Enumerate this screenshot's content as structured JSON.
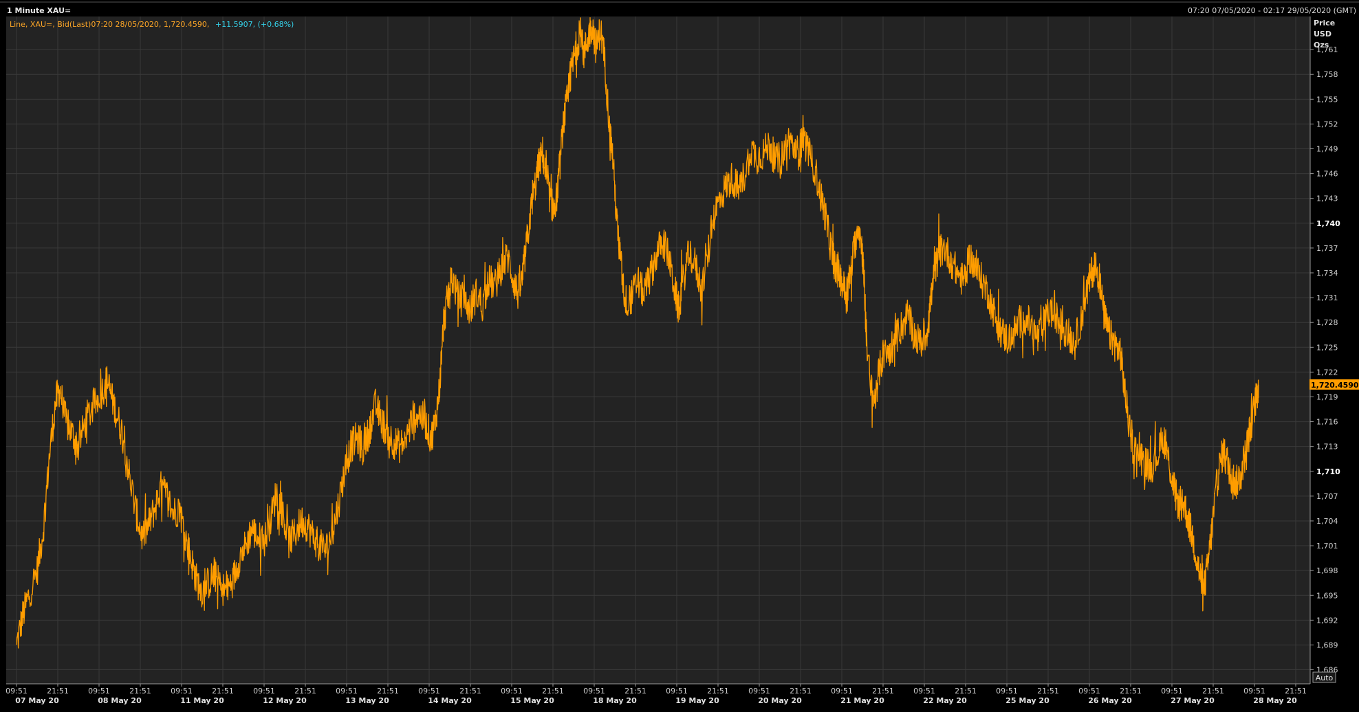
{
  "window": {
    "title": "1 Minute XAU=",
    "time_range": "07:20 07/05/2020 - 02:17 29/05/2020 (GMT)"
  },
  "legend": {
    "text": "Line, XAU=, Bid(Last)07:20 28/05/2020, 1,720.4590,",
    "change": "+11.5907, (+0.68%)",
    "color": "#ffa726",
    "change_color": "#35d2ea"
  },
  "axis_units": {
    "line1": "Price",
    "line2": "USD",
    "line3": "Ozs"
  },
  "auto_button": {
    "label": "Auto"
  },
  "colors": {
    "background": "#232323",
    "grid": "#3a3a3a",
    "line": "#ff9d00",
    "marker_bg": "#ff9d00",
    "marker_text": "#000000"
  },
  "chart_data": {
    "type": "line",
    "title": "1 Minute XAU=",
    "ylabel": "Price USD Ozs",
    "ylim": [
      1684.3,
      1765.0
    ],
    "y_ticks": [
      {
        "value": 1761,
        "label": "1,761",
        "bold": false
      },
      {
        "value": 1758,
        "label": "1,758",
        "bold": false
      },
      {
        "value": 1755,
        "label": "1,755",
        "bold": false
      },
      {
        "value": 1752,
        "label": "1,752",
        "bold": false
      },
      {
        "value": 1749,
        "label": "1,749",
        "bold": false
      },
      {
        "value": 1746,
        "label": "1,746",
        "bold": false
      },
      {
        "value": 1743,
        "label": "1,743",
        "bold": false
      },
      {
        "value": 1740,
        "label": "1,740",
        "bold": true
      },
      {
        "value": 1737,
        "label": "1,737",
        "bold": false
      },
      {
        "value": 1734,
        "label": "1,734",
        "bold": false
      },
      {
        "value": 1731,
        "label": "1,731",
        "bold": false
      },
      {
        "value": 1728,
        "label": "1,728",
        "bold": false
      },
      {
        "value": 1725,
        "label": "1,725",
        "bold": false
      },
      {
        "value": 1722,
        "label": "1,722",
        "bold": false
      },
      {
        "value": 1719,
        "label": "1,719",
        "bold": false
      },
      {
        "value": 1716,
        "label": "1,716",
        "bold": false
      },
      {
        "value": 1713,
        "label": "1,713",
        "bold": false
      },
      {
        "value": 1710,
        "label": "1,710",
        "bold": true
      },
      {
        "value": 1707,
        "label": "1,707",
        "bold": false
      },
      {
        "value": 1704,
        "label": "1,704",
        "bold": false
      },
      {
        "value": 1701,
        "label": "1,701",
        "bold": false
      },
      {
        "value": 1698,
        "label": "1,698",
        "bold": false
      },
      {
        "value": 1695,
        "label": "1,695",
        "bold": false
      },
      {
        "value": 1692,
        "label": "1,692",
        "bold": false
      },
      {
        "value": 1689,
        "label": "1,689",
        "bold": false
      },
      {
        "value": 1686,
        "label": "1,686",
        "bold": false
      }
    ],
    "x_session_ticks": [
      "09:51",
      "21:51",
      "09:51",
      "21:51",
      "09:51",
      "21:51",
      "09:51",
      "21:51",
      "09:51",
      "21:51",
      "09:51",
      "21:51",
      "09:51",
      "21:51",
      "09:51",
      "21:51",
      "09:51",
      "21:51",
      "09:51",
      "21:51",
      "09:51",
      "21:51",
      "09:51",
      "21:51",
      "09:51",
      "21:51",
      "09:51",
      "21:51",
      "09:51",
      "21:51",
      "09:51",
      "21:51"
    ],
    "x_dates": [
      "07 May 20",
      "08 May 20",
      "11 May 20",
      "12 May 20",
      "13 May 20",
      "14 May 20",
      "15 May 20",
      "18 May 20",
      "19 May 20",
      "20 May 20",
      "21 May 20",
      "22 May 20",
      "25 May 20",
      "26 May 20",
      "27 May 20",
      "28 May 20"
    ],
    "last_value": {
      "value": 1720.459,
      "label": "1,720.4590"
    },
    "series": [
      {
        "name": "XAU= Bid(Last)",
        "color": "#ff9d00",
        "points": [
          [
            0.0,
            1689.0
          ],
          [
            0.15,
            1692.5
          ],
          [
            0.3,
            1695.0
          ],
          [
            0.5,
            1698.0
          ],
          [
            0.65,
            1703.0
          ],
          [
            0.8,
            1712.0
          ],
          [
            0.95,
            1718.5
          ],
          [
            1.05,
            1720.0
          ],
          [
            1.2,
            1716.0
          ],
          [
            1.35,
            1714.5
          ],
          [
            1.5,
            1713.0
          ],
          [
            1.7,
            1716.5
          ],
          [
            1.9,
            1718.0
          ],
          [
            2.05,
            1719.5
          ],
          [
            2.2,
            1721.0
          ],
          [
            2.3,
            1719.0
          ],
          [
            2.45,
            1716.5
          ],
          [
            2.6,
            1714.0
          ],
          [
            2.75,
            1709.0
          ],
          [
            2.9,
            1705.0
          ],
          [
            3.05,
            1702.0
          ],
          [
            3.2,
            1703.5
          ],
          [
            3.35,
            1705.5
          ],
          [
            3.5,
            1708.0
          ],
          [
            3.65,
            1707.0
          ],
          [
            3.8,
            1705.0
          ],
          [
            3.95,
            1705.5
          ],
          [
            4.1,
            1702.0
          ],
          [
            4.25,
            1699.0
          ],
          [
            4.35,
            1697.0
          ],
          [
            4.5,
            1695.5
          ],
          [
            4.65,
            1696.5
          ],
          [
            4.8,
            1697.5
          ],
          [
            4.95,
            1696.0
          ],
          [
            5.1,
            1695.5
          ],
          [
            5.25,
            1697.0
          ],
          [
            5.4,
            1699.5
          ],
          [
            5.55,
            1701.0
          ],
          [
            5.7,
            1703.0
          ],
          [
            5.85,
            1702.0
          ],
          [
            6.0,
            1701.5
          ],
          [
            6.15,
            1704.0
          ],
          [
            6.3,
            1707.5
          ],
          [
            6.45,
            1705.0
          ],
          [
            6.6,
            1701.5
          ],
          [
            6.75,
            1702.5
          ],
          [
            6.9,
            1704.0
          ],
          [
            7.05,
            1703.5
          ],
          [
            7.2,
            1702.0
          ],
          [
            7.35,
            1701.0
          ],
          [
            7.5,
            1700.5
          ],
          [
            7.65,
            1702.5
          ],
          [
            7.8,
            1706.0
          ],
          [
            7.95,
            1710.0
          ],
          [
            8.1,
            1713.0
          ],
          [
            8.25,
            1714.0
          ],
          [
            8.4,
            1712.5
          ],
          [
            8.55,
            1715.0
          ],
          [
            8.7,
            1718.0
          ],
          [
            8.85,
            1716.0
          ],
          [
            9.0,
            1714.5
          ],
          [
            9.15,
            1713.5
          ],
          [
            9.3,
            1713.0
          ],
          [
            9.45,
            1714.0
          ],
          [
            9.6,
            1716.5
          ],
          [
            9.75,
            1717.0
          ],
          [
            9.9,
            1716.0
          ],
          [
            10.05,
            1714.0
          ],
          [
            10.15,
            1716.0
          ],
          [
            10.25,
            1720.0
          ],
          [
            10.35,
            1728.0
          ],
          [
            10.45,
            1731.0
          ],
          [
            10.55,
            1733.5
          ],
          [
            10.7,
            1731.0
          ],
          [
            10.85,
            1730.5
          ],
          [
            11.0,
            1729.5
          ],
          [
            11.15,
            1731.5
          ],
          [
            11.3,
            1730.0
          ],
          [
            11.45,
            1733.0
          ],
          [
            11.6,
            1732.5
          ],
          [
            11.75,
            1734.5
          ],
          [
            11.9,
            1736.0
          ],
          [
            12.05,
            1733.0
          ],
          [
            12.15,
            1731.5
          ],
          [
            12.25,
            1733.0
          ],
          [
            12.35,
            1737.0
          ],
          [
            12.45,
            1741.0
          ],
          [
            12.55,
            1744.0
          ],
          [
            12.65,
            1747.0
          ],
          [
            12.75,
            1748.5
          ],
          [
            12.85,
            1745.0
          ],
          [
            12.95,
            1742.5
          ],
          [
            13.05,
            1741.5
          ],
          [
            13.15,
            1746.0
          ],
          [
            13.25,
            1752.0
          ],
          [
            13.35,
            1755.0
          ],
          [
            13.45,
            1758.5
          ],
          [
            13.55,
            1761.0
          ],
          [
            13.65,
            1763.0
          ],
          [
            13.75,
            1760.5
          ],
          [
            13.85,
            1762.5
          ],
          [
            13.95,
            1764.0
          ],
          [
            14.05,
            1761.0
          ],
          [
            14.15,
            1763.5
          ],
          [
            14.25,
            1760.0
          ],
          [
            14.35,
            1753.0
          ],
          [
            14.45,
            1748.0
          ],
          [
            14.55,
            1740.0
          ],
          [
            14.65,
            1735.0
          ],
          [
            14.75,
            1730.5
          ],
          [
            14.9,
            1731.0
          ],
          [
            15.05,
            1733.0
          ],
          [
            15.2,
            1731.5
          ],
          [
            15.35,
            1733.5
          ],
          [
            15.5,
            1736.0
          ],
          [
            15.65,
            1738.0
          ],
          [
            15.8,
            1736.0
          ],
          [
            15.95,
            1732.0
          ],
          [
            16.05,
            1729.5
          ],
          [
            16.15,
            1733.0
          ],
          [
            16.3,
            1736.5
          ],
          [
            16.45,
            1735.0
          ],
          [
            16.6,
            1732.0
          ],
          [
            16.75,
            1736.0
          ],
          [
            16.9,
            1741.0
          ],
          [
            17.05,
            1743.0
          ],
          [
            17.2,
            1744.5
          ],
          [
            17.35,
            1745.5
          ],
          [
            17.5,
            1744.0
          ],
          [
            17.65,
            1746.0
          ],
          [
            17.8,
            1749.0
          ],
          [
            17.95,
            1748.0
          ],
          [
            18.1,
            1748.5
          ],
          [
            18.25,
            1749.5
          ],
          [
            18.4,
            1747.5
          ],
          [
            18.55,
            1748.0
          ],
          [
            18.7,
            1750.0
          ],
          [
            18.85,
            1749.0
          ],
          [
            18.95,
            1748.5
          ],
          [
            19.05,
            1750.5
          ],
          [
            19.2,
            1748.5
          ],
          [
            19.35,
            1746.5
          ],
          [
            19.5,
            1743.0
          ],
          [
            19.6,
            1741.0
          ],
          [
            19.7,
            1738.0
          ],
          [
            19.8,
            1735.5
          ],
          [
            19.9,
            1734.0
          ],
          [
            20.0,
            1733.0
          ],
          [
            20.1,
            1731.5
          ],
          [
            20.2,
            1733.5
          ],
          [
            20.3,
            1737.0
          ],
          [
            20.4,
            1740.0
          ],
          [
            20.5,
            1736.5
          ],
          [
            20.55,
            1732.0
          ],
          [
            20.6,
            1726.0
          ],
          [
            20.7,
            1720.0
          ],
          [
            20.8,
            1718.5
          ],
          [
            20.9,
            1722.0
          ],
          [
            21.0,
            1724.0
          ],
          [
            21.15,
            1724.5
          ],
          [
            21.3,
            1726.0
          ],
          [
            21.45,
            1727.5
          ],
          [
            21.6,
            1729.0
          ],
          [
            21.75,
            1726.5
          ],
          [
            21.9,
            1725.5
          ],
          [
            22.05,
            1726.5
          ],
          [
            22.15,
            1730.5
          ],
          [
            22.25,
            1734.0
          ],
          [
            22.35,
            1736.5
          ],
          [
            22.5,
            1737.0
          ],
          [
            22.65,
            1735.5
          ],
          [
            22.8,
            1734.0
          ],
          [
            22.95,
            1733.0
          ],
          [
            23.1,
            1736.0
          ],
          [
            23.25,
            1734.5
          ],
          [
            23.4,
            1733.0
          ],
          [
            23.55,
            1731.5
          ],
          [
            23.7,
            1729.0
          ],
          [
            23.85,
            1727.0
          ],
          [
            24.0,
            1726.0
          ],
          [
            24.15,
            1726.5
          ],
          [
            24.3,
            1728.0
          ],
          [
            24.45,
            1728.5
          ],
          [
            24.6,
            1727.5
          ],
          [
            24.75,
            1726.0
          ],
          [
            24.9,
            1728.0
          ],
          [
            25.05,
            1729.5
          ],
          [
            25.2,
            1728.5
          ],
          [
            25.35,
            1727.5
          ],
          [
            25.5,
            1726.5
          ],
          [
            25.65,
            1725.5
          ],
          [
            25.8,
            1728.5
          ],
          [
            25.95,
            1732.0
          ],
          [
            26.05,
            1734.0
          ],
          [
            26.15,
            1735.0
          ],
          [
            26.25,
            1733.0
          ],
          [
            26.35,
            1729.0
          ],
          [
            26.45,
            1727.0
          ],
          [
            26.55,
            1726.0
          ],
          [
            26.65,
            1725.0
          ],
          [
            26.75,
            1724.5
          ],
          [
            26.85,
            1720.0
          ],
          [
            26.95,
            1716.0
          ],
          [
            27.05,
            1713.0
          ],
          [
            27.2,
            1712.0
          ],
          [
            27.35,
            1711.0
          ],
          [
            27.5,
            1710.5
          ],
          [
            27.65,
            1712.0
          ],
          [
            27.8,
            1714.0
          ],
          [
            27.9,
            1712.0
          ],
          [
            28.0,
            1709.0
          ],
          [
            28.1,
            1707.0
          ],
          [
            28.2,
            1705.5
          ],
          [
            28.3,
            1706.0
          ],
          [
            28.4,
            1704.0
          ],
          [
            28.5,
            1702.0
          ],
          [
            28.6,
            1699.5
          ],
          [
            28.7,
            1697.0
          ],
          [
            28.75,
            1695.0
          ],
          [
            28.85,
            1698.0
          ],
          [
            28.95,
            1702.0
          ],
          [
            29.05,
            1707.0
          ],
          [
            29.15,
            1710.5
          ],
          [
            29.25,
            1712.5
          ],
          [
            29.35,
            1711.0
          ],
          [
            29.45,
            1709.5
          ],
          [
            29.55,
            1708.5
          ],
          [
            29.65,
            1709.5
          ],
          [
            29.75,
            1711.5
          ],
          [
            29.85,
            1714.0
          ],
          [
            29.95,
            1716.5
          ],
          [
            30.05,
            1719.0
          ],
          [
            30.1,
            1720.459
          ]
        ]
      }
    ]
  }
}
